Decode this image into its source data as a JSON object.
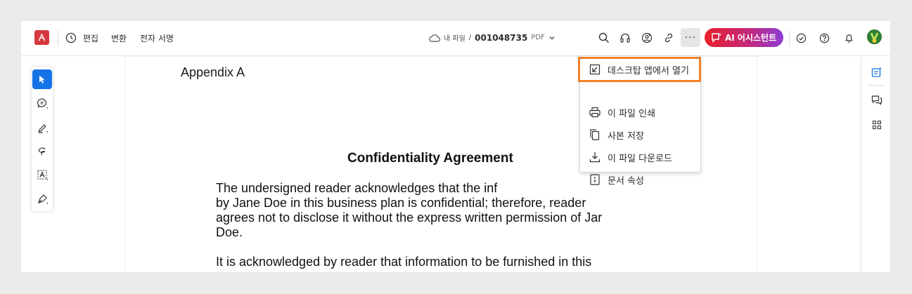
{
  "toolbar": {
    "edit_label": "편집",
    "convert_label": "변환",
    "esign_label": "전자 서명",
    "my_files": "내 파일",
    "separator": "/",
    "file_name": "001048735",
    "file_ext": "PDF",
    "more_label": "···",
    "ai_label": "AI 어시스턴트"
  },
  "menu": {
    "items": [
      {
        "label": "데스크탑 앱에서 열기",
        "icon": "open-external-icon"
      },
      {
        "label": "이 파일 인쇄",
        "icon": "print-icon"
      },
      {
        "label": "사본 저장",
        "icon": "copy-icon"
      },
      {
        "label": "이 파일 다운로드",
        "icon": "download-icon"
      },
      {
        "label": "문서 속성",
        "icon": "info-icon"
      }
    ]
  },
  "document": {
    "heading": "Appendix A",
    "title": "Confidentiality Agreement",
    "para1": [
      "The undersigned reader acknowledges that the inf",
      "by Jane Doe in this business plan is confidential; therefore, reader",
      "agrees not to disclose it without the express written permission of Jar",
      "Doe."
    ],
    "para2": [
      "It is acknowledged by reader that information to be furnished in this"
    ]
  },
  "colors": {
    "accent": "#1473e6",
    "acrobat_red": "#d7373f",
    "highlight": "#f0812a"
  }
}
